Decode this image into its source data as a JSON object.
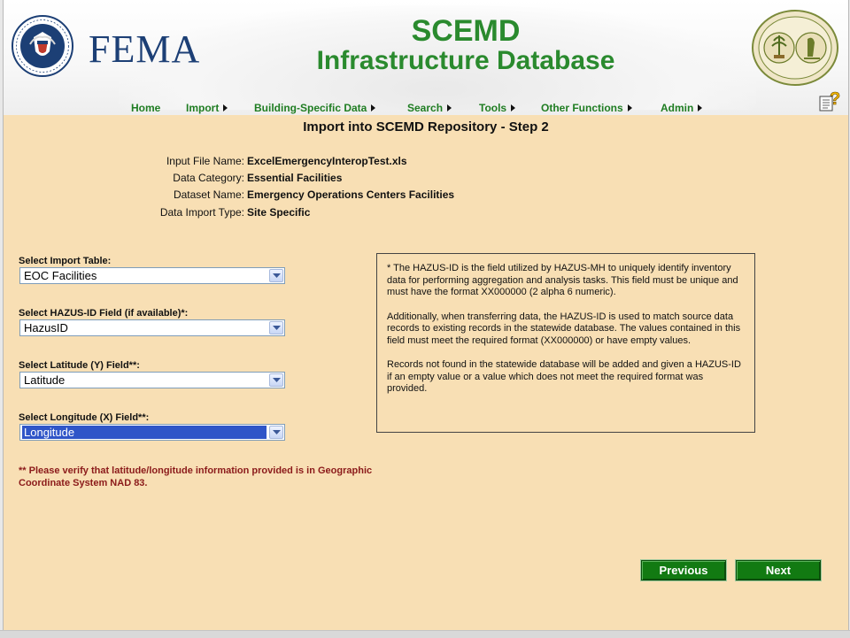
{
  "header": {
    "agency_word": "FEMA",
    "title_line1": "SCEMD",
    "title_line2": "Infrastructure Database",
    "brand_green": "#2a8a2e",
    "brand_blue": "#1c3f75"
  },
  "nav": {
    "items": [
      {
        "label": "Home",
        "has_arrow": false
      },
      {
        "label": "Import",
        "has_arrow": true
      },
      {
        "label": "Building-Specific Data",
        "has_arrow": true
      },
      {
        "label": "Search",
        "has_arrow": true
      },
      {
        "label": "Tools",
        "has_arrow": true
      },
      {
        "label": "Other Functions",
        "has_arrow": true
      },
      {
        "label": "Admin",
        "has_arrow": true
      }
    ],
    "help_icon": "help-question-icon"
  },
  "page": {
    "heading": "Import into SCEMD Repository - Step 2",
    "background": "#f8dfb4"
  },
  "info": {
    "rows": [
      {
        "label": "Input File Name:",
        "value": "ExcelEmergencyInteropTest.xls"
      },
      {
        "label": "Data Category:",
        "value": "Essential Facilities"
      },
      {
        "label": "Dataset Name:",
        "value": "Emergency Operations Centers Facilities"
      },
      {
        "label": "Data Import Type:",
        "value": "Site Specific"
      }
    ]
  },
  "form": {
    "import_table": {
      "label": "Select Import Table:",
      "value": "EOC Facilities"
    },
    "hazus_id": {
      "label": "Select HAZUS-ID Field (if available)*:",
      "value": "HazusID"
    },
    "latitude": {
      "label": "Select Latitude (Y) Field**:",
      "value": "Latitude"
    },
    "longitude": {
      "label": "Select Longitude (X) Field**:",
      "value": "Longitude"
    },
    "note": "** Please verify that latitude/longitude information provided is in Geographic Coordinate System NAD 83."
  },
  "help_box": {
    "paragraphs": [
      "* The HAZUS-ID is the field utilized by HAZUS-MH to uniquely identify inventory data for performing aggregation and analysis tasks. This field must be unique and must have the format XX000000 (2 alpha 6 numeric).",
      "Additionally, when transferring data, the HAZUS-ID is used to match source data records to existing records in the statewide database. The values contained in this field must meet the required format (XX000000) or have empty values.",
      "Records not found in the statewide database will be added and given a HAZUS-ID if an empty value or a value which does not meet the required format was provided."
    ]
  },
  "buttons": {
    "previous": "Previous",
    "next": "Next",
    "color": "#127a12"
  }
}
